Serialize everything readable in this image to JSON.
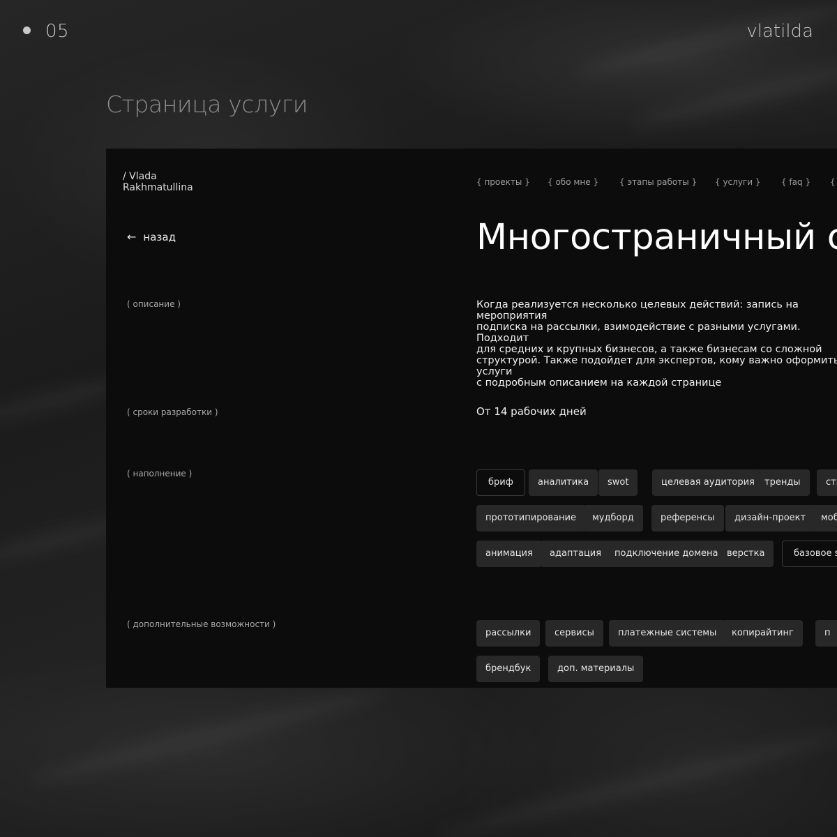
{
  "slide": {
    "number": "05",
    "brand": "vlatilda",
    "section_title": "Страница услуги"
  },
  "site": {
    "logo_line1": "/ Vlada",
    "logo_line2": "Rakhmatullina",
    "nav": [
      "{ проекты }",
      "{ обо мне }",
      "{ этапы работы }",
      "{ услуги }",
      "{ faq }",
      "{ "
    ]
  },
  "page": {
    "back_label": "назад",
    "title": "Многостраничный сай",
    "labels": {
      "description": "( описание )",
      "terms": "( сроки разработки )",
      "content": "( наполнение )",
      "extras": "( дополнительные возможности )"
    },
    "description_lines": [
      "Когда реализуется несколько целевых действий: запись на мероприятия",
      "подписка на рассылки, взимодействие с разными услугами. Подходит",
      "для средних и крупных бизнесов, а также бизнесам со сложной",
      "структурой. Также подойдет для экспертов, кому важно оформить услуги",
      "с подробным описанием на каждой странице"
    ],
    "terms": "От 14 рабочих дней",
    "content_tags": [
      [
        "бриф",
        "аналитика",
        "swot",
        "целевая аудитория",
        "тренды",
        "стр"
      ],
      [
        "прототипирование",
        "мудборд",
        "референсы",
        "дизайн-проект",
        "моби"
      ],
      [
        "анимация",
        "адаптация",
        "подключение домена",
        "верстка",
        "базовое se"
      ]
    ],
    "extras_tags": [
      [
        "рассылки",
        "сервисы",
        "платежные системы",
        "копирайтинг",
        "п"
      ],
      [
        "брендбук",
        "доп. материалы"
      ]
    ]
  },
  "colors": {
    "panel": "#0c0c0c",
    "tag": "#282828",
    "muted": "#8d8d8d"
  }
}
